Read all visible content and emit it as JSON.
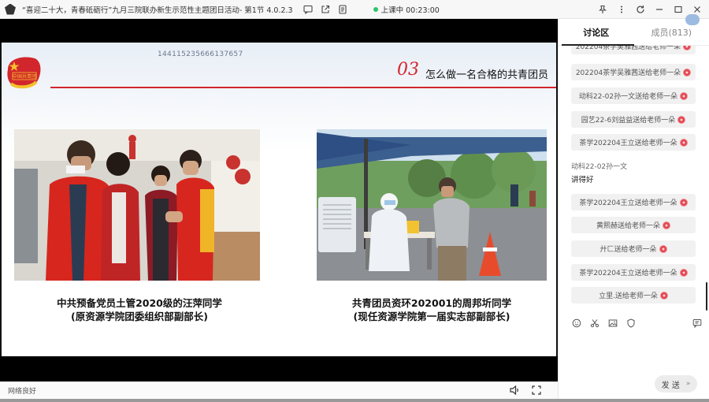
{
  "window": {
    "title": "“喜迎二十大，青春砥砺行”九月三院联办新生示范性主题团日活动- 第1节 4.0.2.3",
    "live_status": "上课中 00:23:00"
  },
  "slide": {
    "watermark_id": "144115235666137657",
    "number": "03",
    "heading": "怎么做一名合格的共青团员",
    "captions": [
      {
        "line1": "中共预备党员土管2020级的汪萍同学",
        "line2": "(原资源学院团委组织部副部长)"
      },
      {
        "line1": "共青团员资环202001的周邦圻同学",
        "line2": "(现任资源学院第一届实志部副部长)"
      }
    ],
    "emblem_text": "中国共青团"
  },
  "bottom_bar": {
    "network_status": "网络良好"
  },
  "sidebar": {
    "tabs": [
      {
        "label": "讨论区",
        "active": true
      },
      {
        "label": "成员(813)",
        "active": false
      }
    ],
    "messages": [
      {
        "type": "gift",
        "text": "202204茶学吴雅茜送给老师一朵"
      },
      {
        "type": "gift",
        "text": "动科22-02孙一文送给老师一朵"
      },
      {
        "type": "gift",
        "text": "园艺22-6刘益益送给老师一朵"
      },
      {
        "type": "gift",
        "text": "茶学202204王立送给老师一朵"
      },
      {
        "type": "text",
        "sender": "动科22-02孙一文",
        "text": "讲得好"
      },
      {
        "type": "gift",
        "text": "茶学202204王立送给老师一朵"
      },
      {
        "type": "gift",
        "text": "黄熙赫送给老师一朵"
      },
      {
        "type": "gift",
        "text": "廾匚送给老师一朵"
      },
      {
        "type": "gift",
        "text": "茶学202204王立送给老师一朵"
      },
      {
        "type": "gift",
        "text": "立里.送给老师一朵"
      }
    ],
    "send_label": "发 送",
    "send_arrow": "»"
  },
  "colors": {
    "accent_red": "#d2262d",
    "live_green": "#2ec26b"
  }
}
